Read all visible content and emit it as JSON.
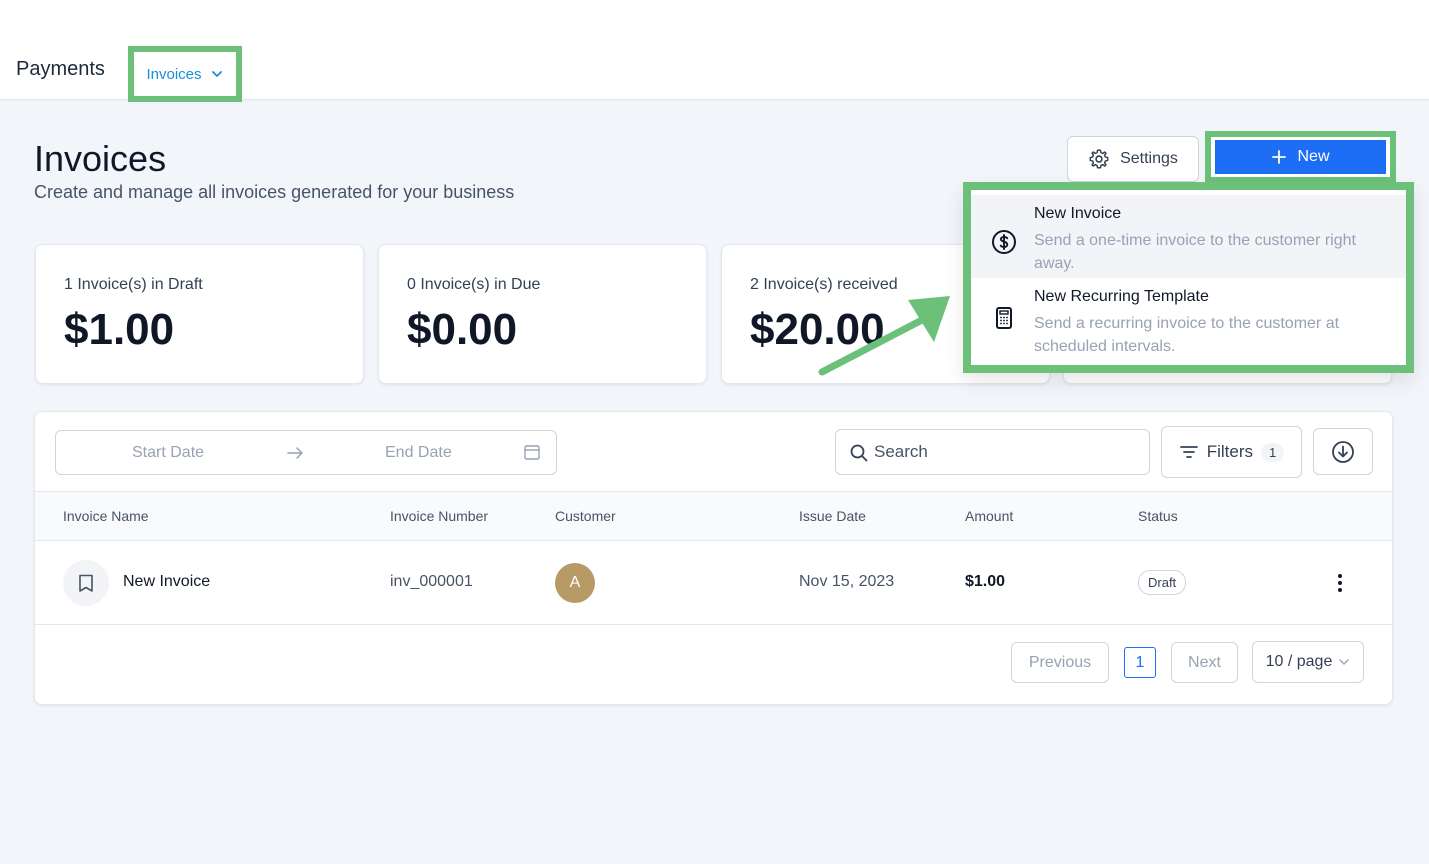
{
  "header": {
    "brand": "Payments",
    "tab_label": "Invoices"
  },
  "page": {
    "title": "Invoices",
    "subtitle": "Create and manage all invoices generated for your business"
  },
  "actions": {
    "settings_label": "Settings",
    "new_label": "New"
  },
  "new_menu": {
    "items": [
      {
        "title": "New Invoice",
        "description": "Send a one-time invoice to the customer right away.",
        "icon": "dollar-circle-icon"
      },
      {
        "title": "New Recurring Template",
        "description": "Send a recurring invoice to the customer at scheduled intervals.",
        "icon": "calculator-icon"
      }
    ]
  },
  "stats": [
    {
      "label": "1 Invoice(s) in Draft",
      "value": "$1.00"
    },
    {
      "label": "0 Invoice(s) in Due",
      "value": "$0.00"
    },
    {
      "label": "2 Invoice(s) received",
      "value": "$20.00"
    }
  ],
  "filters": {
    "start_date_placeholder": "Start Date",
    "end_date_placeholder": "End Date",
    "search_placeholder": "Search",
    "filters_label": "Filters",
    "filters_count": "1"
  },
  "table": {
    "columns": [
      "Invoice Name",
      "Invoice Number",
      "Customer",
      "Issue Date",
      "Amount",
      "Status"
    ],
    "rows": [
      {
        "name": "New Invoice",
        "number": "inv_000001",
        "customer_initial": "A",
        "issue_date": "Nov 15, 2023",
        "amount": "$1.00",
        "status": "Draft"
      }
    ]
  },
  "pagination": {
    "previous_label": "Previous",
    "current_page": "1",
    "next_label": "Next",
    "page_size_label": "10 / page"
  },
  "colors": {
    "primary": "#1e6ef5",
    "highlight": "#6cc07a",
    "tab_link": "#1a8fd6",
    "avatar": "#b89a66"
  }
}
